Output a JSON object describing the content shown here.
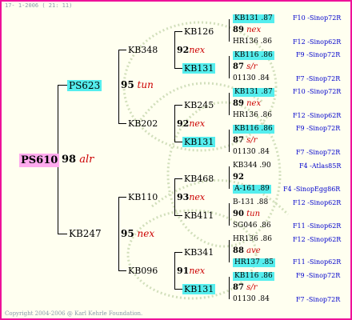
{
  "header": "17- 1-2006 ( 21: 11)",
  "footer": "Copyright 2004-2006 @ Karl Kehrle Foundation.",
  "root": "PS610",
  "g1": [
    {
      "num": "98",
      "tag": "alr"
    }
  ],
  "g2": [
    "PS623",
    "KB247"
  ],
  "g2_pair": [
    {
      "num": "95",
      "tag": "tun"
    },
    {
      "num": "95",
      "tag": "nex"
    }
  ],
  "g3": [
    "KB348",
    "KB202",
    "KB110",
    "KB096"
  ],
  "g3_pair": [
    {
      "num": "92",
      "tag": "nex"
    },
    {
      "num": "92",
      "tag": "nex"
    },
    {
      "num": "93",
      "tag": "nex"
    },
    {
      "num": "91",
      "tag": "nex"
    }
  ],
  "g4": [
    "KB126",
    "KB131",
    "KB245",
    "KB131",
    "KB468",
    "KB411",
    "KB341",
    "KB131"
  ],
  "g5": [
    {
      "top": "KB131 .87",
      "num": "89",
      "tag": "nex",
      "bot": "HR136 .86",
      "src_top": "F10 -Sinop72R",
      "src_bot": "F12 -Sinop62R"
    },
    {
      "top": "KB116 .86",
      "num": "87",
      "tag": "s/r",
      "bot": "01130 .84",
      "src_top": "F9 -Sinop72R",
      "src_bot": "F7 -Sinop72R"
    },
    {
      "top": "KB131 .87",
      "num": "89",
      "tag": "nex",
      "bot": "HR136 .86",
      "src_top": "F10 -Sinop72R",
      "src_bot": "F12 -Sinop62R"
    },
    {
      "top": "KB116 .86",
      "num": "87",
      "tag": "s/r",
      "bot": "01130 .84",
      "src_top": "F9 -Sinop72R",
      "src_bot": "F7 -Sinop72R"
    },
    {
      "top": "KB344 .90",
      "num": "92",
      "tag": "",
      "bot": "A-161 .89",
      "src_top": "F4 -Atlas85R",
      "src_bot": "F4 -SinopEgg86R"
    },
    {
      "top": "B-131 .88",
      "num": "90",
      "tag": "tun",
      "bot": "SG046 .86",
      "src_top": "F12 -Sinop62R",
      "src_bot": "F11 -Sinop62R"
    },
    {
      "top": "HR136 .86",
      "num": "88",
      "tag": "ave",
      "bot": "HR137 .85",
      "src_top": "F12 -Sinop62R",
      "src_bot": "F11 -Sinop62R"
    },
    {
      "top": "KB116 .86",
      "num": "87",
      "tag": "s/r",
      "bot": "01130 .84",
      "src_top": "F9 -Sinop72R",
      "src_bot": "F7 -Sinop72R"
    }
  ]
}
